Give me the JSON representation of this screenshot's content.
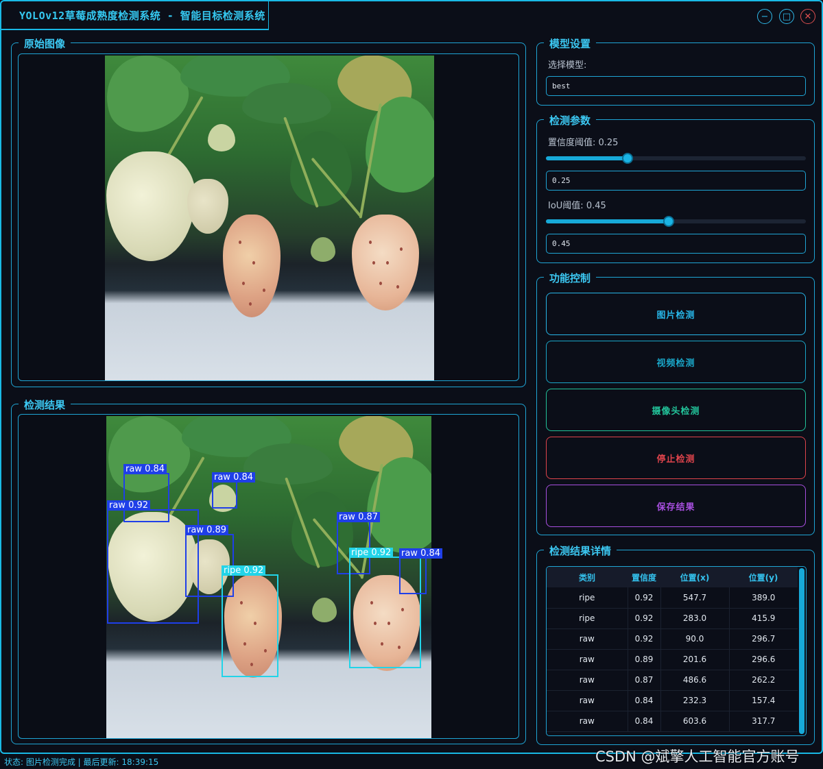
{
  "window": {
    "title": "YOLOv12草莓成熟度检测系统 - 智能目标检测系统",
    "min_glyph": "−",
    "max_glyph": "□",
    "close_glyph": "✕"
  },
  "panels": {
    "original_title": "原始图像",
    "result_title": "检测结果",
    "model_title": "模型设置",
    "params_title": "检测参数",
    "control_title": "功能控制",
    "details_title": "检测结果详情"
  },
  "model": {
    "select_label": "选择模型:",
    "selected": "best"
  },
  "params": {
    "conf_label": "置信度阈值: 0.25",
    "conf_value": "0.25",
    "conf_level": 0.25,
    "iou_label": "IoU阈值: 0.45",
    "iou_value": "0.45",
    "iou_level": 0.45
  },
  "controls": {
    "image_detect": "图片检测",
    "video_detect": "视频检测",
    "camera_detect": "摄像头检测",
    "stop_detect": "停止检测",
    "save_result": "保存结果"
  },
  "colors": {
    "accent": "#19b9e6",
    "image_btn": "#27b6e8",
    "video_btn": "#1aa6c8",
    "camera_btn": "#22c39a",
    "stop_btn": "#e0444c",
    "save_btn": "#a84fe0",
    "raw_box": "#1f3fe8",
    "ripe_box": "#22d4e8"
  },
  "detections": [
    {
      "label": "raw 0.84",
      "cls": "raw"
    },
    {
      "label": "raw 0.84",
      "cls": "raw"
    },
    {
      "label": "raw 0.92",
      "cls": "raw"
    },
    {
      "label": "raw 0.89",
      "cls": "raw"
    },
    {
      "label": "ripe 0.92",
      "cls": "ripe"
    },
    {
      "label": "raw 0.87",
      "cls": "raw"
    },
    {
      "label": "ripe 0.92",
      "cls": "ripe"
    },
    {
      "label": "raw 0.84",
      "cls": "raw"
    }
  ],
  "table": {
    "headers": [
      "类别",
      "置信度",
      "位置(x)",
      "位置(y)"
    ],
    "rows": [
      [
        "ripe",
        "0.92",
        "547.7",
        "389.0"
      ],
      [
        "ripe",
        "0.92",
        "283.0",
        "415.9"
      ],
      [
        "raw",
        "0.92",
        "90.0",
        "296.7"
      ],
      [
        "raw",
        "0.89",
        "201.6",
        "296.6"
      ],
      [
        "raw",
        "0.87",
        "486.6",
        "262.2"
      ],
      [
        "raw",
        "0.84",
        "232.3",
        "157.4"
      ],
      [
        "raw",
        "0.84",
        "603.6",
        "317.7"
      ]
    ]
  },
  "status": {
    "text": "状态: 图片检测完成 | 最后更新: 18:39:15"
  },
  "watermark": "CSDN @斌擎人工智能官方账号"
}
